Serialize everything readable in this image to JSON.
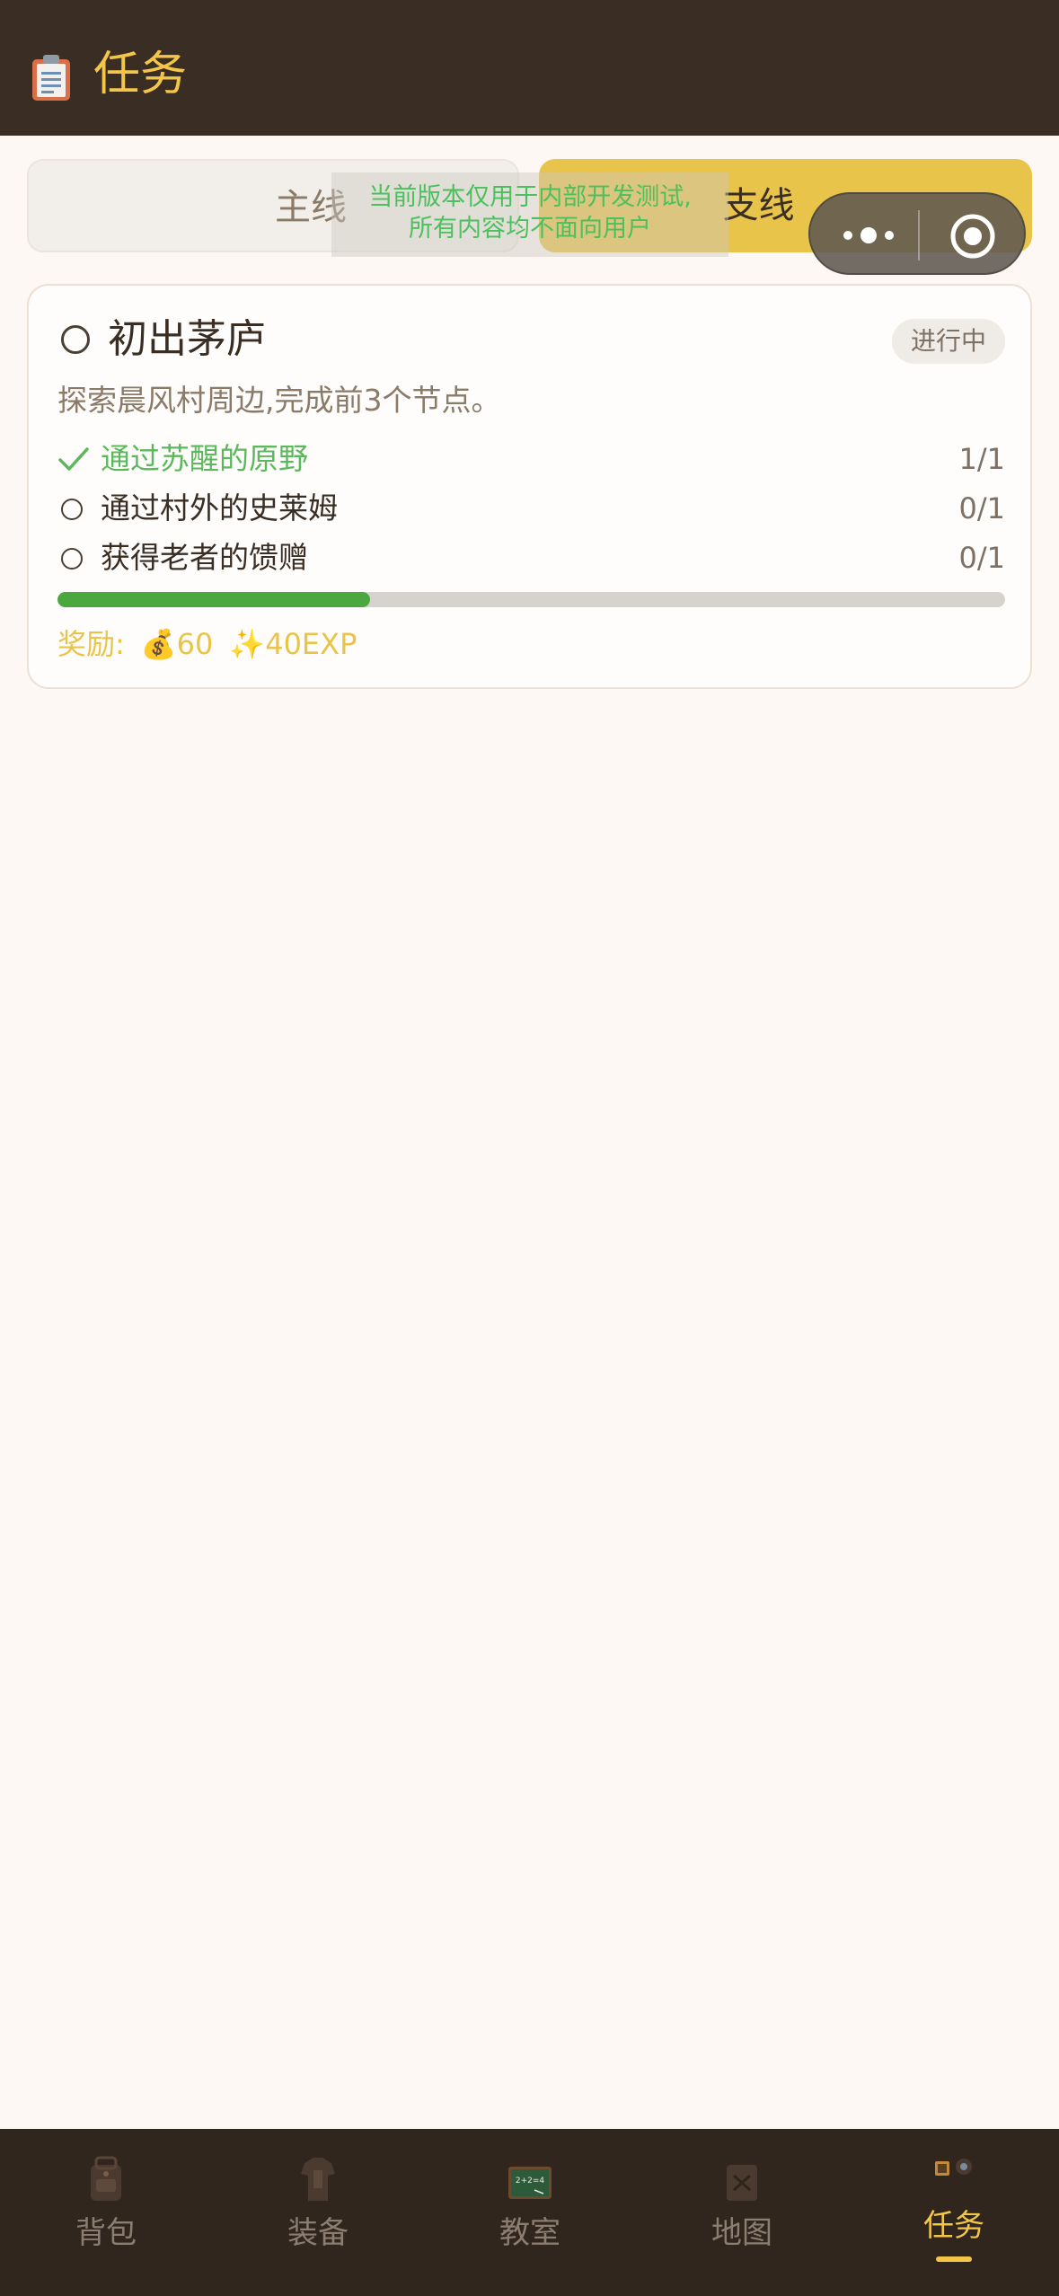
{
  "header": {
    "title": "任务",
    "icon": "clipboard-icon"
  },
  "tabs": {
    "main_label": "主线",
    "side_label": "支线",
    "active": "side"
  },
  "dev_banner": {
    "line1": "当前版本仅用于内部开发测试,",
    "line2": "所有内容均不面向用户"
  },
  "capsule": {
    "more_icon": "more-dots-icon",
    "close_icon": "target-close-icon"
  },
  "quest": {
    "title": "初出茅庐",
    "status": "进行中",
    "description": "探索晨风村周边,完成前3个节点。",
    "objectives": [
      {
        "label": "通过苏醒的原野",
        "count": "1/1",
        "done": true
      },
      {
        "label": "通过村外的史莱姆",
        "count": "0/1",
        "done": false
      },
      {
        "label": "获得老者的馈赠",
        "count": "0/1",
        "done": false
      }
    ],
    "progress": 0.33,
    "reward_label": "奖励:",
    "reward_gold": "💰60",
    "reward_exp": "✨40EXP"
  },
  "tabbar": {
    "items": [
      {
        "label": "背包",
        "icon": "backpack-icon"
      },
      {
        "label": "装备",
        "icon": "armor-icon"
      },
      {
        "label": "教室",
        "icon": "chalkboard-icon"
      },
      {
        "label": "地图",
        "icon": "map-icon"
      },
      {
        "label": "任务",
        "icon": "quest-icon",
        "active": true
      }
    ]
  },
  "colors": {
    "accent": "#f3c64a",
    "header_bg": "#3a2e24",
    "success": "#5cb85c",
    "progress": "#4aa83e"
  }
}
